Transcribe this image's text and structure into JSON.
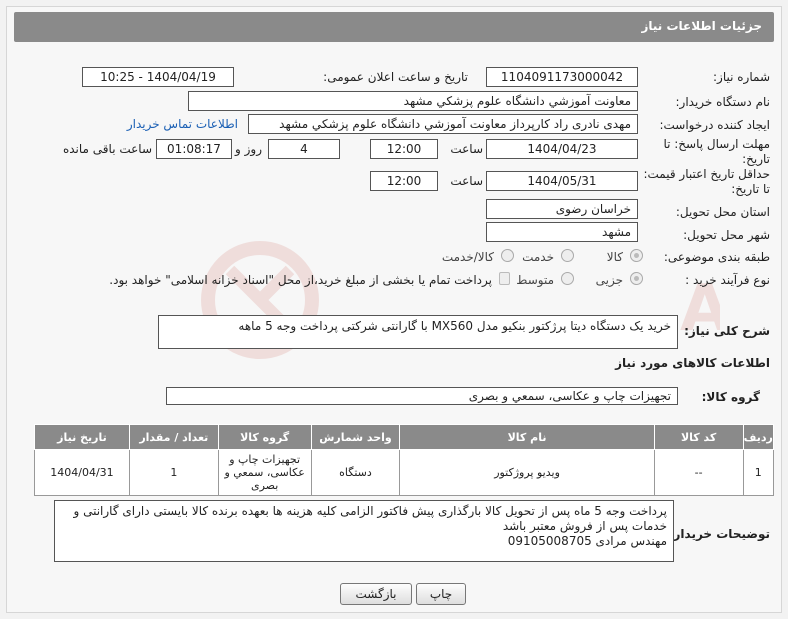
{
  "header": {
    "title": "جزئیات اطلاعات نیاز"
  },
  "fields": {
    "need_number_label": "شماره نیاز:",
    "need_number": "1104091173000042",
    "announce_label": "تاریخ و ساعت اعلان عمومی:",
    "announce_value": "1404/04/19 - 10:25",
    "buyer_org_label": "نام دستگاه خریدار:",
    "buyer_org": "معاونت آموزشي دانشگاه علوم پزشکي مشهد",
    "creator_label": "ایجاد کننده درخواست:",
    "creator": "مهدی نادری راد کارپرداز معاونت آموزشي دانشگاه علوم پزشکي مشهد",
    "contact_link": "اطلاعات تماس خریدار",
    "deadline_label_1": "مهلت ارسال پاسخ: تا",
    "deadline_label_2": "تاریخ:",
    "deadline_date": "1404/04/23",
    "time_label": "ساعت",
    "deadline_time": "12:00",
    "days_value": "4",
    "days_label": "روز و",
    "remaining_time": "01:08:17",
    "remaining_label": "ساعت باقی مانده",
    "validity_label_1": "حداقل تاریخ اعتبار قیمت:",
    "validity_label_2": "تا تاریخ:",
    "validity_date": "1404/05/31",
    "validity_time": "12:00",
    "province_label": "استان محل تحویل:",
    "province": "خراسان رضوی",
    "city_label": "شهر محل تحویل:",
    "city": "مشهد",
    "category_label": "طبقه بندی موضوعی:",
    "category_options": [
      "کالا",
      "خدمت",
      "کالا/خدمت"
    ],
    "category_selected": "کالا",
    "process_label": "نوع فرآیند خرید :",
    "process_options": [
      "جزیی",
      "متوسط"
    ],
    "process_selected": "جزیی",
    "payment_note": "پرداخت تمام یا بخشی از مبلغ خرید،از محل \"اسناد خزانه اسلامی\" خواهد بود.",
    "description_label": "شرح کلی نیاز:",
    "description": "خرید یک دستگاه دیتا پرژکتور بنکیو مدل MX560 با گارانتی شرکتی پرداخت وجه 5 ماهه"
  },
  "goods_section": {
    "title": "اطلاعات کالاهای مورد نیاز",
    "group_label": "گروه کالا:",
    "group_value": "تجهیزات چاپ و عکاسی، سمعي و بصری"
  },
  "table": {
    "headers": [
      "ردیف",
      "کد کالا",
      "نام کالا",
      "واحد شمارش",
      "گروه کالا",
      "تعداد / مقدار",
      "تاریخ نیاز"
    ],
    "rows": [
      [
        "1",
        "--",
        "ویدیو پروژکتور",
        "دستگاه",
        "تجهیزات چاپ و عکاسی، سمعي و بصری",
        "1",
        "1404/04/31"
      ]
    ]
  },
  "buyer_notes": {
    "label": "توضیحات خریدار:",
    "text": "پرداخت وجه 5 ماه پس از تحویل کالا بارگذاری پیش فاکتور الزامی   کلیه هزینه ها بعهده برنده کالا بایستی دارای گارانتی و خدمات پس از فروش معتبر باشد\nمهندس مرادی 09105008705"
  },
  "buttons": {
    "print": "چاپ",
    "back": "بازگشت"
  },
  "watermark_text": "AriaTender.neT",
  "colors": {
    "header_bg": "#8a8a8a",
    "link": "#1a5fb4",
    "watermark": "#c0392b"
  }
}
